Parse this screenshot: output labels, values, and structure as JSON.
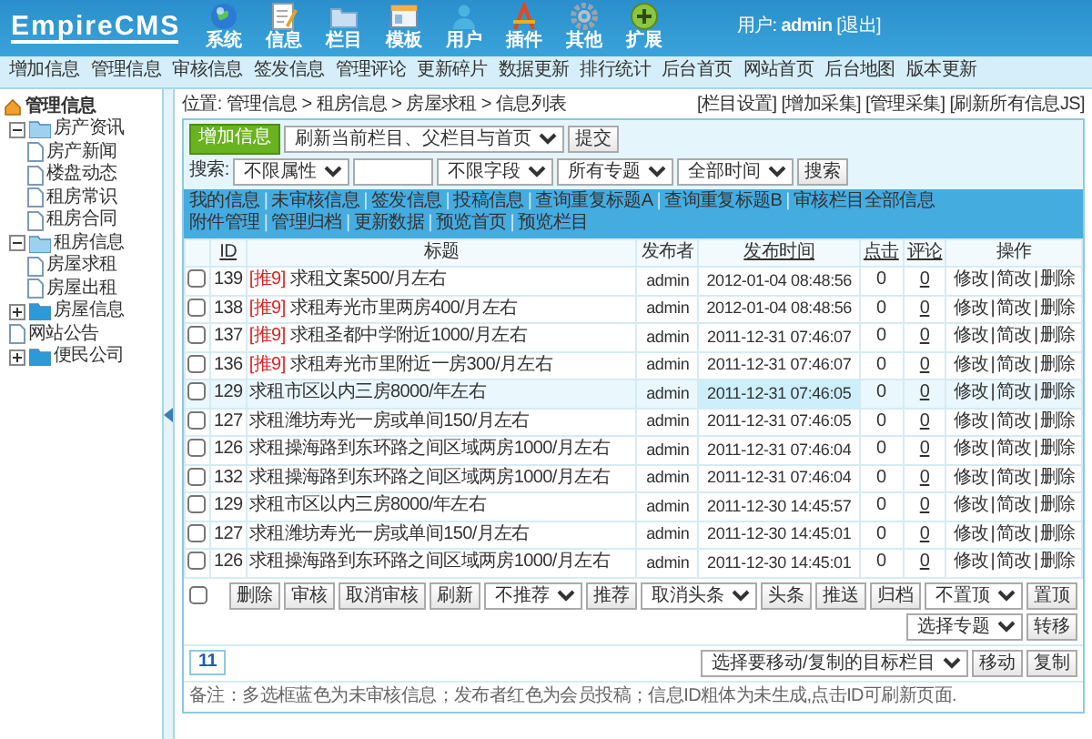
{
  "header": {
    "logo": "EmpireCMS",
    "menu": [
      {
        "label": "系统"
      },
      {
        "label": "信息"
      },
      {
        "label": "栏目"
      },
      {
        "label": "模板"
      },
      {
        "label": "用户"
      },
      {
        "label": "插件"
      },
      {
        "label": "其他"
      },
      {
        "label": "扩展"
      }
    ],
    "user_label": "用户:",
    "user": "admin",
    "logout": "[退出]"
  },
  "nav": [
    "增加信息",
    "管理信息",
    "审核信息",
    "签发信息",
    "管理评论",
    "更新碎片",
    "数据更新",
    "排行统计",
    "后台首页",
    "网站首页",
    "后台地图",
    "版本更新"
  ],
  "sidebar": {
    "root": "管理信息",
    "items": [
      {
        "label": "房产资讯",
        "kind": "folder",
        "expanded": true,
        "children": [
          {
            "label": "房产新闻",
            "kind": "page"
          },
          {
            "label": "楼盘动态",
            "kind": "page"
          },
          {
            "label": "租房常识",
            "kind": "page"
          },
          {
            "label": "租房合同",
            "kind": "page"
          }
        ]
      },
      {
        "label": "租房信息",
        "kind": "folder",
        "expanded": true,
        "children": [
          {
            "label": "房屋求租",
            "kind": "page"
          },
          {
            "label": "房屋出租",
            "kind": "page"
          }
        ]
      },
      {
        "label": "房屋信息",
        "kind": "folder",
        "expanded": false
      },
      {
        "label": "网站公告",
        "kind": "page"
      },
      {
        "label": "便民公司",
        "kind": "folder",
        "expanded": false
      }
    ]
  },
  "breadcrumb": {
    "label": "位置:",
    "path": [
      "管理信息",
      "租房信息",
      "房屋求租",
      "信息列表"
    ],
    "separator": ">",
    "links": [
      "[栏目设置]",
      "[增加采集]",
      "[管理采集]",
      "[刷新所有信息JS]"
    ]
  },
  "toolbar": {
    "add_button": "增加信息",
    "refresh_select": "刷新当前栏目、父栏目与首页",
    "submit": "提交",
    "search_label": "搜索:",
    "attribute_select": "不限属性",
    "field_select": "不限字段",
    "topic_select": "所有专题",
    "time_select": "全部时间",
    "search_button": "搜索"
  },
  "tabs": {
    "separator": "|",
    "left": [
      "我的信息",
      "未审核信息",
      "签发信息",
      "投稿信息",
      "查询重复标题A",
      "查询重复标题B",
      "审核栏目全部信息"
    ],
    "right": [
      "附件管理",
      "管理归档",
      "更新数据",
      "预览首页",
      "预览栏目"
    ]
  },
  "table": {
    "columns": [
      {
        "label": "ID",
        "sortable": true
      },
      {
        "label": "标题",
        "sortable": false
      },
      {
        "label": "发布者",
        "sortable": false
      },
      {
        "label": "发布时间",
        "sortable": true
      },
      {
        "label": "点击",
        "sortable": true
      },
      {
        "label": "评论",
        "sortable": true
      },
      {
        "label": "操作",
        "sortable": false
      }
    ],
    "action_separator": "|",
    "rows": [
      {
        "checked": false,
        "selected": false,
        "id": "139",
        "tag": "[推9]",
        "title": "求租文案500/月左右",
        "publisher": "admin",
        "time": "2012-01-04 08:48:56",
        "clicks": "0",
        "comments": "0",
        "actions": [
          "修改",
          "简改",
          "删除"
        ]
      },
      {
        "checked": false,
        "selected": false,
        "id": "138",
        "tag": "[推9]",
        "title": "求租寿光市里两房400/月左右",
        "publisher": "admin",
        "time": "2012-01-04 08:48:56",
        "clicks": "0",
        "comments": "0",
        "actions": [
          "修改",
          "简改",
          "删除"
        ]
      },
      {
        "checked": false,
        "selected": false,
        "id": "137",
        "tag": "[推9]",
        "title": "求租圣都中学附近1000/月左右",
        "publisher": "admin",
        "time": "2011-12-31 07:46:07",
        "clicks": "0",
        "comments": "0",
        "actions": [
          "修改",
          "简改",
          "删除"
        ]
      },
      {
        "checked": false,
        "selected": false,
        "id": "136",
        "tag": "[推9]",
        "title": "求租寿光市里附近一房300/月左右",
        "publisher": "admin",
        "time": "2011-12-31 07:46:07",
        "clicks": "0",
        "comments": "0",
        "actions": [
          "修改",
          "简改",
          "删除"
        ]
      },
      {
        "checked": false,
        "selected": true,
        "id": "129",
        "title": "求租市区以内三房8000/年左右",
        "publisher": "admin",
        "time": "2011-12-31 07:46:05",
        "clicks": "0",
        "comments": "0",
        "actions": [
          "修改",
          "简改",
          "删除"
        ]
      },
      {
        "checked": false,
        "selected": false,
        "id": "127",
        "title": "求租潍坊寿光一房或单间150/月左右",
        "publisher": "admin",
        "time": "2011-12-31 07:46:05",
        "clicks": "0",
        "comments": "0",
        "actions": [
          "修改",
          "简改",
          "删除"
        ]
      },
      {
        "checked": false,
        "selected": false,
        "id": "126",
        "title": "求租操海路到东环路之间区域两房1000/月左右",
        "publisher": "admin",
        "time": "2011-12-31 07:46:04",
        "clicks": "0",
        "comments": "0",
        "actions": [
          "修改",
          "简改",
          "删除"
        ]
      },
      {
        "checked": false,
        "selected": false,
        "id": "132",
        "title": "求租操海路到东环路之间区域两房1000/月左右",
        "publisher": "admin",
        "time": "2011-12-31 07:46:04",
        "clicks": "0",
        "comments": "0",
        "actions": [
          "修改",
          "简改",
          "删除"
        ]
      },
      {
        "checked": false,
        "selected": false,
        "id": "129",
        "title": "求租市区以内三房8000/年左右",
        "publisher": "admin",
        "time": "2011-12-30 14:45:57",
        "clicks": "0",
        "comments": "0",
        "actions": [
          "修改",
          "简改",
          "删除"
        ]
      },
      {
        "checked": false,
        "selected": false,
        "id": "127",
        "title": "求租潍坊寿光一房或单间150/月左右",
        "publisher": "admin",
        "time": "2011-12-30 14:45:01",
        "clicks": "0",
        "comments": "0",
        "actions": [
          "修改",
          "简改",
          "删除"
        ]
      },
      {
        "checked": false,
        "selected": false,
        "id": "126",
        "title": "求租操海路到东环路之间区域两房1000/月左右",
        "publisher": "admin",
        "time": "2011-12-30 14:45:01",
        "clicks": "0",
        "comments": "0",
        "actions": [
          "修改",
          "简改",
          "删除"
        ]
      }
    ]
  },
  "bulk": {
    "checked": false,
    "items": [
      {
        "kind": "button",
        "label": "删除"
      },
      {
        "kind": "button",
        "label": "审核"
      },
      {
        "kind": "button",
        "label": "取消审核"
      },
      {
        "kind": "button",
        "label": "刷新"
      },
      {
        "kind": "select",
        "label": "不推荐"
      },
      {
        "kind": "button",
        "label": "推荐"
      },
      {
        "kind": "select",
        "label": "取消头条"
      },
      {
        "kind": "button",
        "label": "头条"
      },
      {
        "kind": "button",
        "label": "推送"
      },
      {
        "kind": "button",
        "label": "归档"
      },
      {
        "kind": "select",
        "label": "不置顶"
      },
      {
        "kind": "button",
        "label": "置顶"
      },
      {
        "kind": "select",
        "label": "选择专题"
      },
      {
        "kind": "button",
        "label": "转移"
      }
    ]
  },
  "pager": {
    "page": "11",
    "move_select": "选择要移动/复制的目标栏目",
    "move": "移动",
    "copy": "复制"
  },
  "note": "备注：多选框蓝色为未审核信息；发布者红色为会员投稿；信息ID粗体为未生成,点击ID可刷新页面."
}
